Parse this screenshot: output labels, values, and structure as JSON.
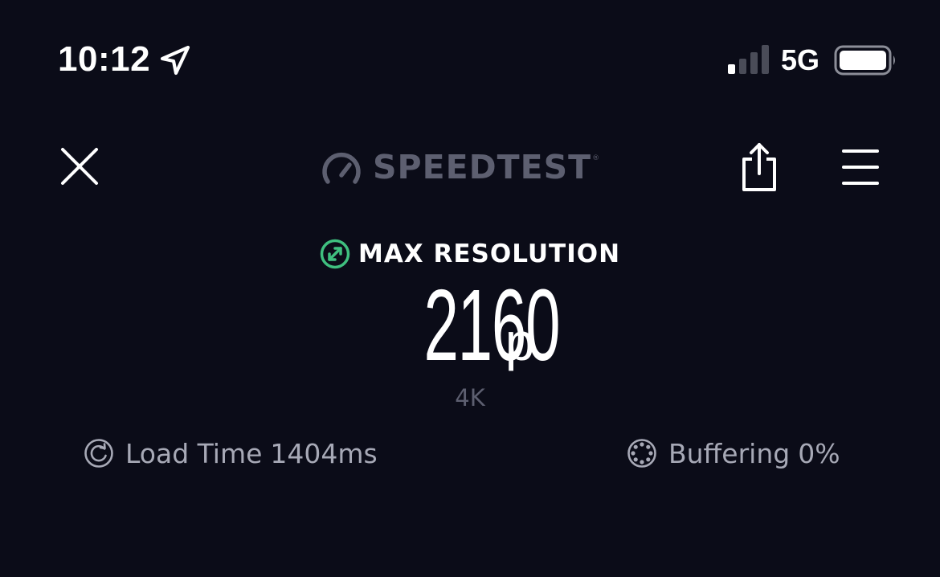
{
  "status_bar": {
    "time": "10:12",
    "network": "5G",
    "icons": [
      "location-arrow-icon",
      "cellular-signal-icon",
      "battery-icon"
    ]
  },
  "header": {
    "brand": "SPEEDTEST",
    "trademark": "®",
    "icons": [
      "close-icon",
      "speedometer-gauge-icon",
      "share-icon",
      "hamburger-menu-icon"
    ]
  },
  "result": {
    "label": "MAX RESOLUTION",
    "value": "2160",
    "unit": "p",
    "quality": "4K",
    "icon": "expand-arrows-icon"
  },
  "metrics": {
    "load_time": {
      "label": "Load Time",
      "value": "1404ms",
      "icon": "refresh-circle-icon"
    },
    "buffering": {
      "label": "Buffering",
      "value": "0%",
      "icon": "buffering-ring-icon"
    }
  },
  "colors": {
    "background": "#0b0c18",
    "accent_green": "#3fbf7f",
    "muted_text": "#5d5f70",
    "secondary_text": "#a7a9b6"
  }
}
